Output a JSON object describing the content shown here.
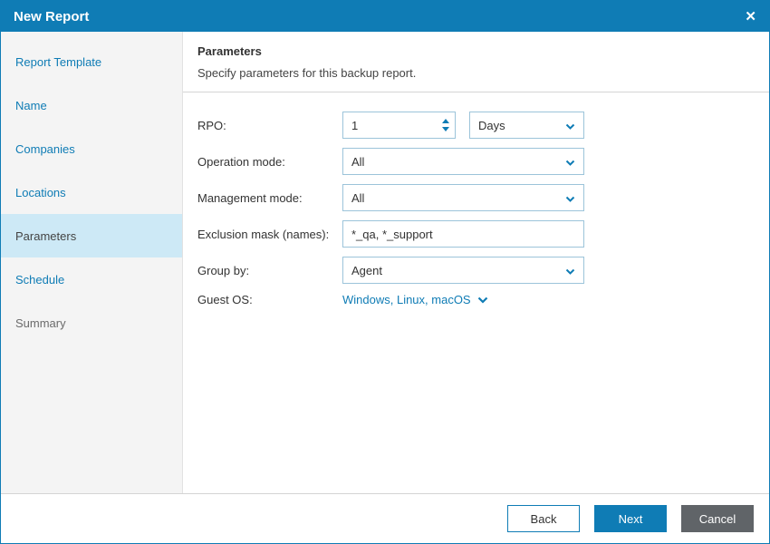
{
  "window": {
    "title": "New Report",
    "close_glyph": "✕"
  },
  "sidebar": {
    "items": [
      {
        "label": "Report Template",
        "state": "link"
      },
      {
        "label": "Name",
        "state": "link"
      },
      {
        "label": "Companies",
        "state": "link"
      },
      {
        "label": "Locations",
        "state": "link"
      },
      {
        "label": "Parameters",
        "state": "active"
      },
      {
        "label": "Schedule",
        "state": "link"
      },
      {
        "label": "Summary",
        "state": "disabled"
      }
    ]
  },
  "content": {
    "title": "Parameters",
    "subtitle": "Specify parameters for this backup report.",
    "form": {
      "rpo": {
        "label": "RPO:",
        "value": "1",
        "unit": "Days"
      },
      "operation_mode": {
        "label": "Operation mode:",
        "value": "All"
      },
      "management_mode": {
        "label": "Management mode:",
        "value": "All"
      },
      "exclusion_mask": {
        "label": "Exclusion mask (names):",
        "value": "*_qa, *_support"
      },
      "group_by": {
        "label": "Group by:",
        "value": "Agent"
      },
      "guest_os": {
        "label": "Guest OS:",
        "value": "Windows, Linux, macOS"
      }
    }
  },
  "footer": {
    "back_label": "Back",
    "next_label": "Next",
    "cancel_label": "Cancel"
  },
  "colors": {
    "accent": "#0f7cb5",
    "active_step_bg": "#cde9f6",
    "sidebar_bg": "#f4f4f4",
    "input_border": "#9cc4da",
    "cancel_bg": "#606468"
  }
}
